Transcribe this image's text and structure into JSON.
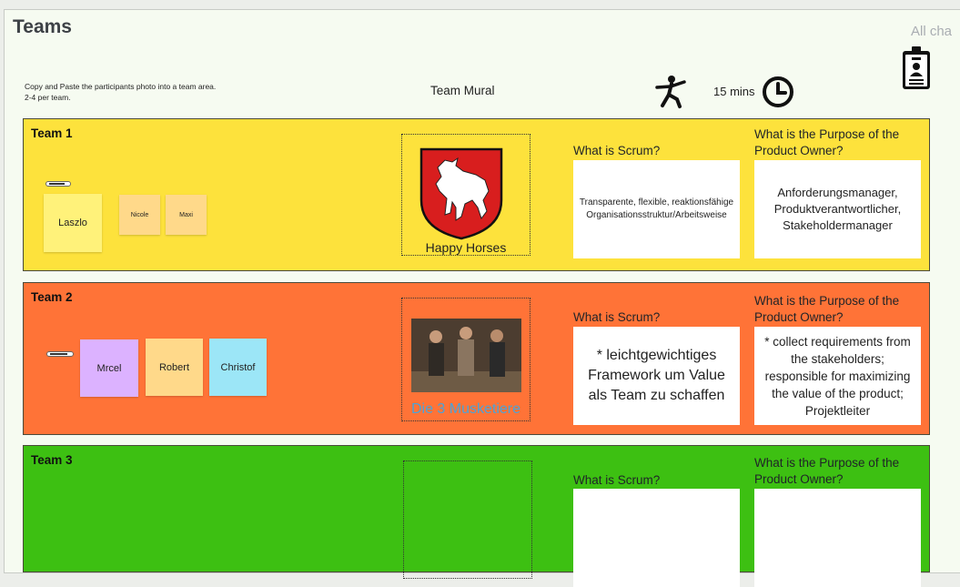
{
  "board": {
    "title": "Teams",
    "top_right_text": "All cha",
    "instructions": [
      "Copy and Paste the participants photo into a team area.",
      "2-4 per team."
    ],
    "mural_label": "Team Mural",
    "timer": "15 mins",
    "icons": [
      "id-badge-icon",
      "running-person-icon",
      "clock-icon"
    ]
  },
  "teams": [
    {
      "label": "Team 1",
      "color": "#fde23c",
      "team_name": "Happy Horses",
      "participants": [
        "Laszlo",
        "Nicole",
        "Maxi"
      ],
      "q_scrum": "What is Scrum?",
      "a_scrum": "Transparente, flexible, reaktionsfähige Organisationsstruktur/Arbeitsweise",
      "q_po": "What is the Purpose of the Product Owner?",
      "a_po": "Anforderungsmanager, Produktverantwortlicher, Stakeholdermanager"
    },
    {
      "label": "Team 2",
      "color": "#ff7337",
      "team_name": "Die 3 Musketiere",
      "participants": [
        "Mrcel",
        "Robert",
        "Christof"
      ],
      "q_scrum": "What is Scrum?",
      "a_scrum": "* leichtgewichtiges Framework um Value als Team zu schaffen",
      "q_po": "What is the Purpose of the Product Owner?",
      "a_po": "* collect requirements from the stakeholders; responsible  for maximizing the value of the product; Projektleiter"
    },
    {
      "label": "Team 3",
      "color": "#3dc012",
      "team_name": "",
      "participants": [],
      "q_scrum": "What is Scrum?",
      "a_scrum": "",
      "q_po": "What is the Purpose of the Product Owner?",
      "a_po": ""
    }
  ],
  "colors": {
    "sticky_yellow": "#fff27a",
    "sticky_peach": "#ffd98a",
    "sticky_lavender": "#dcb2ff",
    "sticky_cyan": "#9ce6f7",
    "team_name_link": "#4aa3d8"
  }
}
